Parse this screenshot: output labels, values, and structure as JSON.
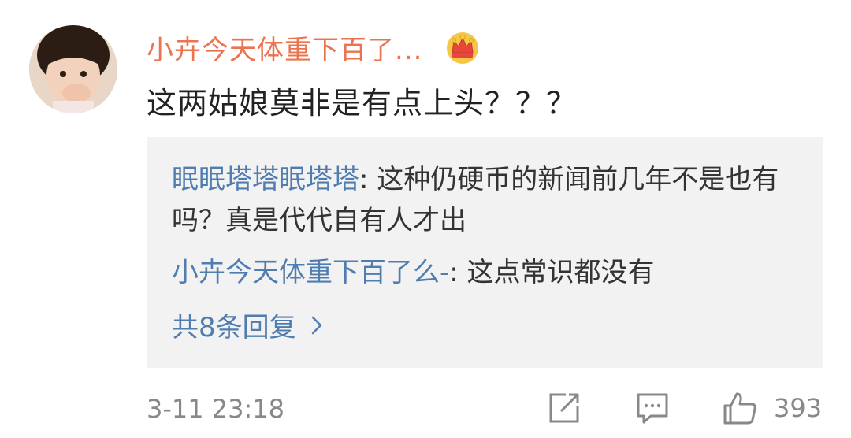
{
  "comment": {
    "username": "小卉今天体重下百了...",
    "text": "这两姑娘莫非是有点上头？？？",
    "timestamp": "3-11 23:18",
    "like_count": "393"
  },
  "replies": [
    {
      "author": "眠眠塔塔眠塔塔",
      "text": ": 这种仍硬币的新闻前几年不是也有吗？真是代代自有人才出"
    },
    {
      "author": "小卉今天体重下百了么-",
      "text": ": 这点常识都没有"
    }
  ],
  "more_replies_label": "共8条回复",
  "icons": {
    "crown": "crown-icon",
    "share": "share-icon",
    "comment": "comment-icon",
    "like": "thumbs-up-icon",
    "chevron": "chevron-right-icon"
  },
  "colors": {
    "username": "#eb7350",
    "link": "#507daf",
    "reply_bg": "#f2f2f2",
    "meta": "#888888"
  }
}
